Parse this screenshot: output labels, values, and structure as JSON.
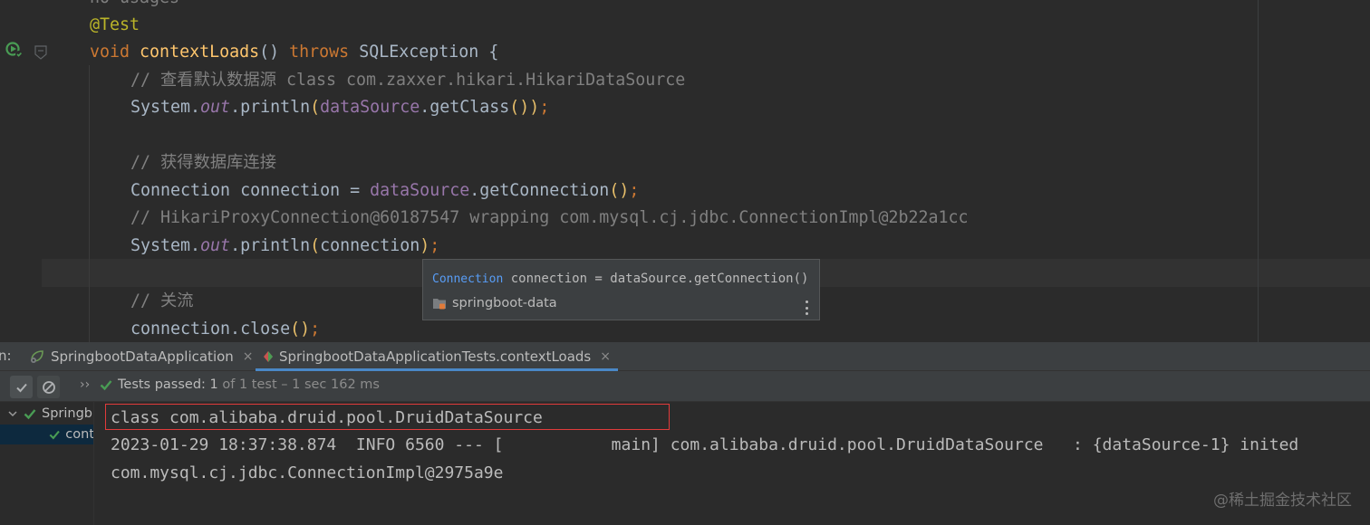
{
  "editor": {
    "lines": {
      "usages": "no usages",
      "annotation": "@Test",
      "sig_void": "void",
      "sig_name": "contextLoads",
      "sig_parens": "()",
      "sig_throws": "throws",
      "sig_exception": "SQLException",
      "sig_brace": "{",
      "comment1": "// 查看默认数据源 class com.zaxxer.hikari.HikariDataSource",
      "print1_sys": "System.",
      "print1_out": "out",
      "print1_println": ".println",
      "print1_open": "(",
      "print1_ds": "dataSource",
      "print1_getclass": ".getClass",
      "print1_inner": "()",
      "print1_close": ")",
      "print1_semi": ";",
      "comment2": "// 获得数据库连接",
      "conn_decl": "Connection connection = ",
      "conn_ds": "dataSource",
      "conn_call": ".getConnection",
      "conn_parens": "()",
      "conn_semi": ";",
      "comment3": "// HikariProxyConnection@60187547 wrapping com.mysql.cj.jdbc.ConnectionImpl@2b22a1cc",
      "print2_sys": "System.",
      "print2_out": "out",
      "print2_println": ".println",
      "print2_open": "(",
      "print2_arg": "connection",
      "print2_close": ")",
      "print2_semi": ";",
      "comment4": "// 关流",
      "close_call": "connection.close",
      "close_parens": "()",
      "close_semi": ";"
    }
  },
  "popup": {
    "type": "Connection",
    "signature": " connection = dataSource.getConnection()",
    "module": "springboot-data"
  },
  "run_window": {
    "prefix": "n:",
    "tabs": [
      {
        "label": "SpringbootDataApplication",
        "close": "×"
      },
      {
        "label": "SpringbootDataApplicationTests.contextLoads",
        "close": "×"
      }
    ],
    "toolbar": {
      "chevrons": "››",
      "status_label": "Tests passed: 1",
      "status_detail": " of 1 test – 1 sec 162 ms"
    },
    "tree": [
      {
        "label": "Springb"
      },
      {
        "label": "cont"
      }
    ],
    "console": [
      "class com.alibaba.druid.pool.DruidDataSource",
      "2023-01-29 18:37:38.874  INFO 6560 --- [           main] com.alibaba.druid.pool.DruidDataSource   : {dataSource-1} inited",
      "com.mysql.cj.jdbc.ConnectionImpl@2975a9e"
    ]
  },
  "watermark": "@稀土掘金技术社区",
  "colors": {
    "editor_bg": "#2b2b2b",
    "keyword": "#cc7832",
    "method": "#ffc66d",
    "comment": "#808080",
    "field": "#9876aa",
    "annotation": "#bbb529",
    "pass_green": "#499c54",
    "highlight_red": "#e23b3b"
  }
}
